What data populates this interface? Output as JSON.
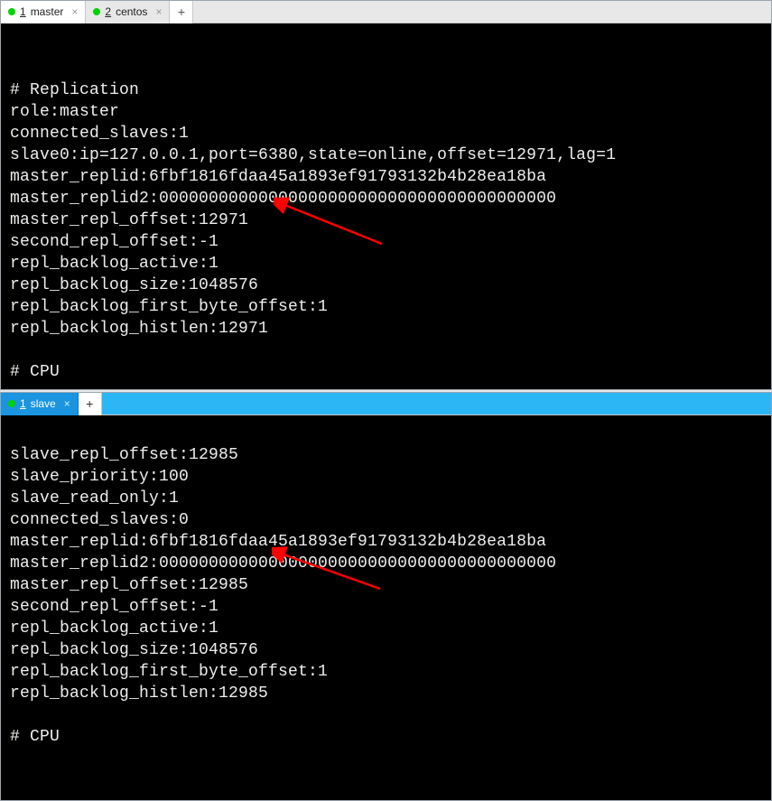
{
  "panelTop": {
    "tabs": [
      {
        "num": "1",
        "label": "master",
        "status": "green"
      },
      {
        "num": "2",
        "label": "centos",
        "status": "green"
      }
    ],
    "lines": [
      "",
      "# Replication",
      "role:master",
      "connected_slaves:1",
      "slave0:ip=127.0.0.1,port=6380,state=online,offset=12971,lag=1",
      "master_replid:6fbf1816fdaa45a1893ef91793132b4b28ea18ba",
      "master_replid2:0000000000000000000000000000000000000000",
      "master_repl_offset:12971",
      "second_repl_offset:-1",
      "repl_backlog_active:1",
      "repl_backlog_size:1048576",
      "repl_backlog_first_byte_offset:1",
      "repl_backlog_histlen:12971",
      "",
      "# CPU"
    ]
  },
  "panelBottom": {
    "tabs": [
      {
        "num": "1",
        "label": "slave",
        "status": "green"
      }
    ],
    "lines": [
      "slave_repl_offset:12985",
      "slave_priority:100",
      "slave_read_only:1",
      "connected_slaves:0",
      "master_replid:6fbf1816fdaa45a1893ef91793132b4b28ea18ba",
      "master_replid2:0000000000000000000000000000000000000000",
      "master_repl_offset:12985",
      "second_repl_offset:-1",
      "repl_backlog_active:1",
      "repl_backlog_size:1048576",
      "repl_backlog_first_byte_offset:1",
      "repl_backlog_histlen:12985",
      "",
      "# CPU"
    ]
  },
  "annotations": {
    "arrowColor": "#ff0000"
  }
}
